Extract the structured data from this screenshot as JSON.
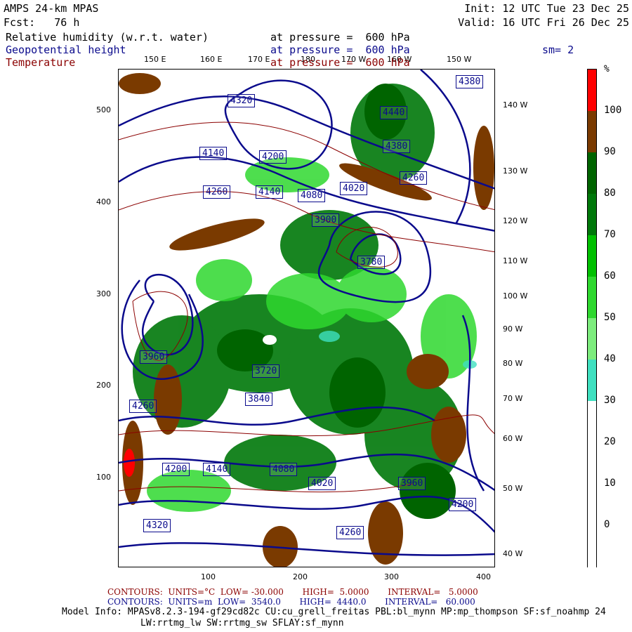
{
  "header": {
    "model": "AMPS 24-km MPAS",
    "forecast": "Fcst:   76 h",
    "init": "Init: 12 UTC Tue 23 Dec 25",
    "valid": "Valid: 16 UTC Fri 26 Dec 25",
    "fields": [
      {
        "name": "Relative humidity (w.r.t. water)",
        "level": "at pressure =  600 hPa",
        "color": "#000000"
      },
      {
        "name": "Geopotential height",
        "level": "at pressure =  600 hPa",
        "color": "#0a0a8c"
      },
      {
        "name": "Temperature",
        "level": "at pressure =  600 hPa",
        "color": "#8b0000"
      }
    ],
    "smoothing": "sm= 2"
  },
  "axes": {
    "top_lon": [
      "150 E",
      "160 E",
      "170 E",
      "180",
      "170 W",
      "160 W",
      "150 W"
    ],
    "right_lon": [
      "140 W",
      "130 W",
      "120 W",
      "110 W",
      "100 W",
      "90 W",
      "80 W",
      "70 W",
      "60 W",
      "50 W",
      "40 W"
    ],
    "left_y": [
      "500",
      "400",
      "300",
      "200",
      "100"
    ],
    "bottom_x": [
      "100",
      "200",
      "300",
      "400"
    ]
  },
  "colorbar": {
    "unit": "%",
    "labels": [
      "100",
      "90",
      "80",
      "70",
      "60",
      "50",
      "40",
      "30",
      "20",
      "10",
      "0"
    ],
    "colors": [
      "#ff0000",
      "#7a3a00",
      "#006400",
      "#00780a",
      "#00c000",
      "#2fd82f",
      "#7dec7d",
      "#3fe0c0",
      "#ffffff"
    ]
  },
  "height_labels": [
    "4440",
    "4380",
    "4380",
    "4320",
    "4260",
    "4260",
    "4200",
    "4140",
    "4140",
    "4080",
    "4020",
    "3960",
    "3900",
    "3840",
    "3780",
    "3720",
    "4260",
    "4200",
    "4140",
    "4080",
    "4020",
    "3960",
    "4320",
    "4260",
    "4200"
  ],
  "footer": {
    "temp_contours": "CONTOURS:  UNITS=°C  LOW= -30.000       HIGH=  5.0000       INTERVAL=   5.0000",
    "height_contours": "CONTOURS:  UNITS=m  LOW=  3540.0       HIGH=  4440.0       INTERVAL=   60.000",
    "model_info": "Model Info: MPASv8.2.3-194-gf29cd82c CU:cu_grell_freitas PBL:bl_mynn MP:mp_thompson SF:sf_noahmp 24",
    "model_info2": "LW:rrtmg_lw SW:rrtmg_sw SFLAY:sf_mynn"
  }
}
